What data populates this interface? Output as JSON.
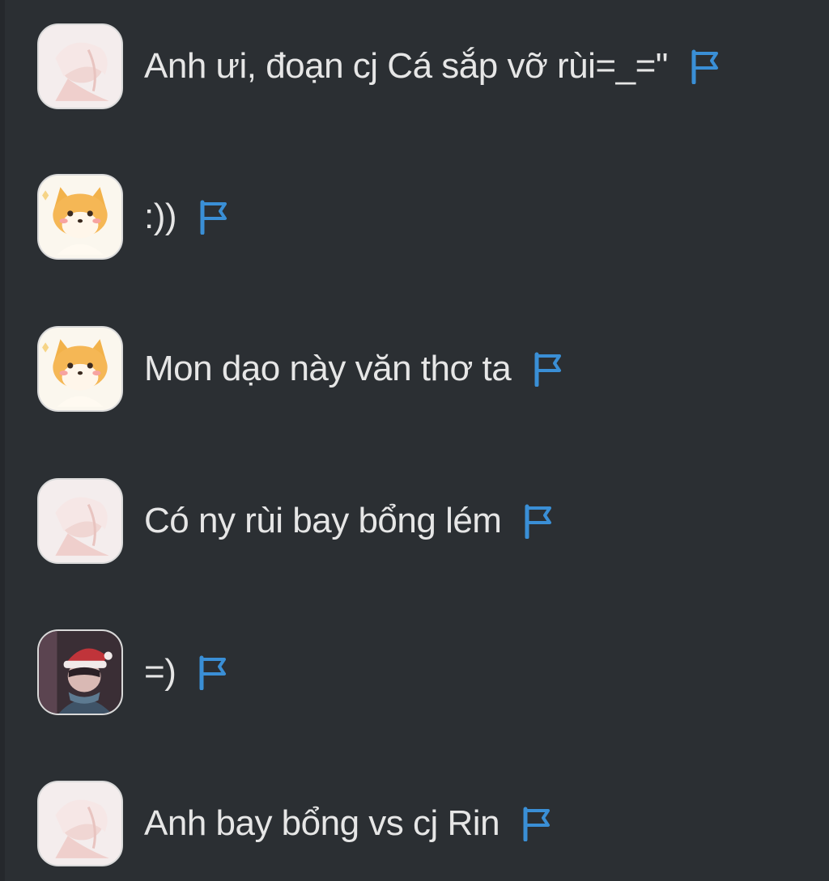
{
  "messages": [
    {
      "avatar": "pastel-girl-avatar",
      "text": "Anh ưi, đoạn cj Cá sắp vỡ rùi=_=\"",
      "action_icon": "flag-icon"
    },
    {
      "avatar": "shiba-dog-avatar",
      "text": ":))",
      "action_icon": "flag-icon"
    },
    {
      "avatar": "shiba-dog-avatar",
      "text": "Mon dạo này văn thơ ta",
      "action_icon": "flag-icon"
    },
    {
      "avatar": "pastel-girl-avatar",
      "text": "Có ny rùi bay bổng lém",
      "action_icon": "flag-icon"
    },
    {
      "avatar": "santa-hat-character-avatar",
      "text": "=)",
      "action_icon": "flag-icon"
    },
    {
      "avatar": "pastel-girl-avatar",
      "text": "Anh bay bổng vs cj Rin",
      "action_icon": "flag-icon"
    }
  ],
  "colors": {
    "background": "#2b2f33",
    "text": "#e6e6e6",
    "flag": "#3a8fd6"
  }
}
